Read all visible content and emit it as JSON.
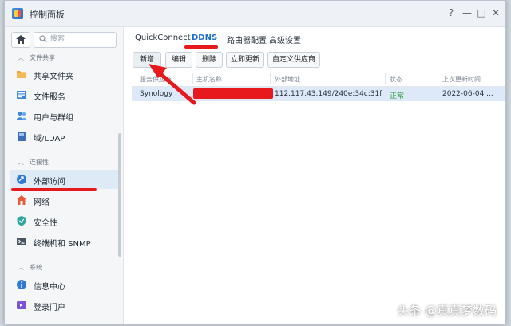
{
  "window": {
    "title": "控制面板",
    "buttons": {
      "help": "?",
      "minimize": "—",
      "maximize": "□",
      "close": "✕"
    }
  },
  "sidebar": {
    "search_placeholder": "搜索",
    "sections": [
      {
        "label": "文件共享",
        "items": [
          "共享文件夹",
          "文件服务",
          "用户与群组",
          "域/LDAP"
        ]
      },
      {
        "label": "连接性",
        "items": [
          "外部访问",
          "网络",
          "安全性",
          "终端机和 SNMP"
        ]
      },
      {
        "label": "系统",
        "items": [
          "信息中心",
          "登录门户"
        ]
      }
    ],
    "active_item": "外部访问"
  },
  "tabs": [
    "QuickConnect",
    "DDNS",
    "路由器配置",
    "高级设置"
  ],
  "active_tab": "DDNS",
  "toolbar": [
    "新增",
    "编辑",
    "删除",
    "立即更新",
    "自定义供应商"
  ],
  "table": {
    "columns": [
      "服务供应商",
      "主机名称",
      "外部地址",
      "状态",
      "上次更新时间"
    ],
    "rows": [
      {
        "provider": "Synology",
        "hostname": "",
        "address": "112.117.43.149/240e:34c:31f:...",
        "status": "正常",
        "updated": "2022-06-04 ..."
      }
    ]
  },
  "watermark": "头条 @真真梦数码",
  "colors": {
    "accent": "#1f6fd1",
    "annotation_red": "#e8191c",
    "selected_row": "#dde9f8",
    "ok_green": "#2e9a3c"
  }
}
